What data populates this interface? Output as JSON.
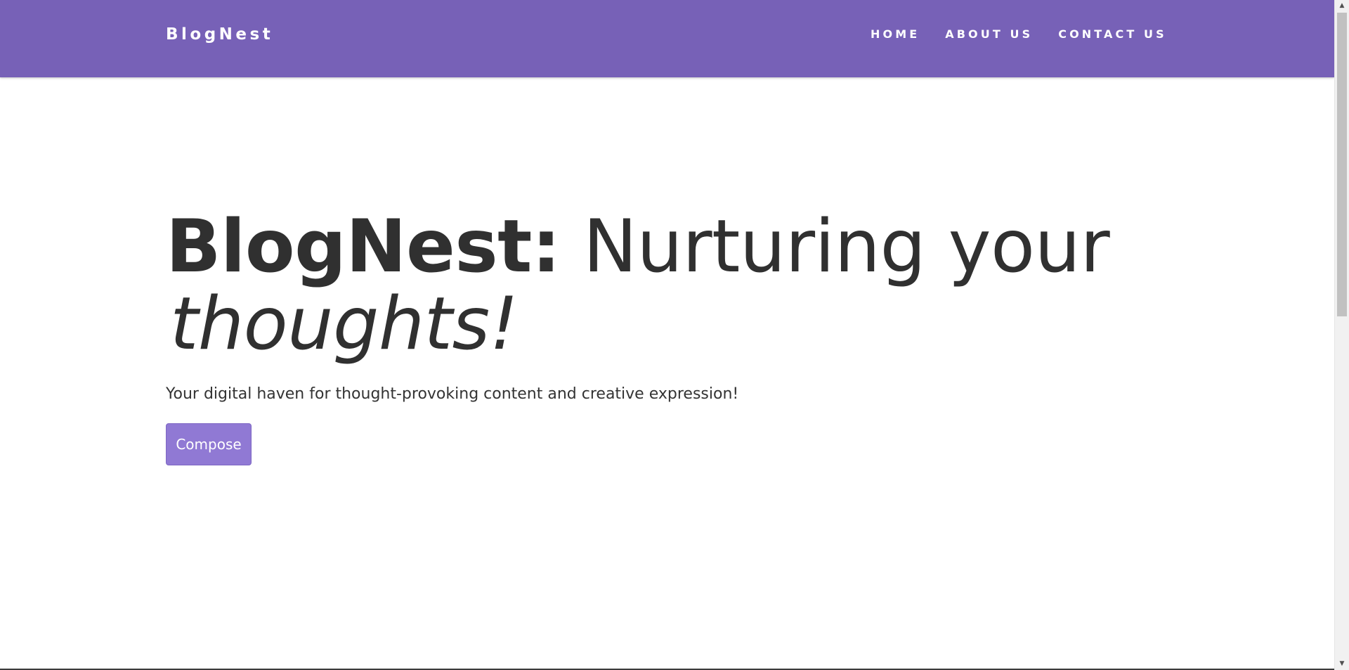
{
  "navbar": {
    "brand": "BlogNest",
    "links": [
      {
        "label": "HOME"
      },
      {
        "label": "ABOUT US"
      },
      {
        "label": "CONTACT US"
      }
    ],
    "background_color": "#7761b7"
  },
  "hero": {
    "title_strong": "BlogNest:",
    "title_regular": "Nurturing your",
    "title_italic": "thoughts!",
    "subtitle": "Your digital haven for thought-provoking content and creative expression!",
    "compose_label": "Compose",
    "button_color": "#9079d4"
  },
  "scrollbar": {
    "up_icon": "triangle-up-icon",
    "down_icon": "triangle-down-icon"
  }
}
